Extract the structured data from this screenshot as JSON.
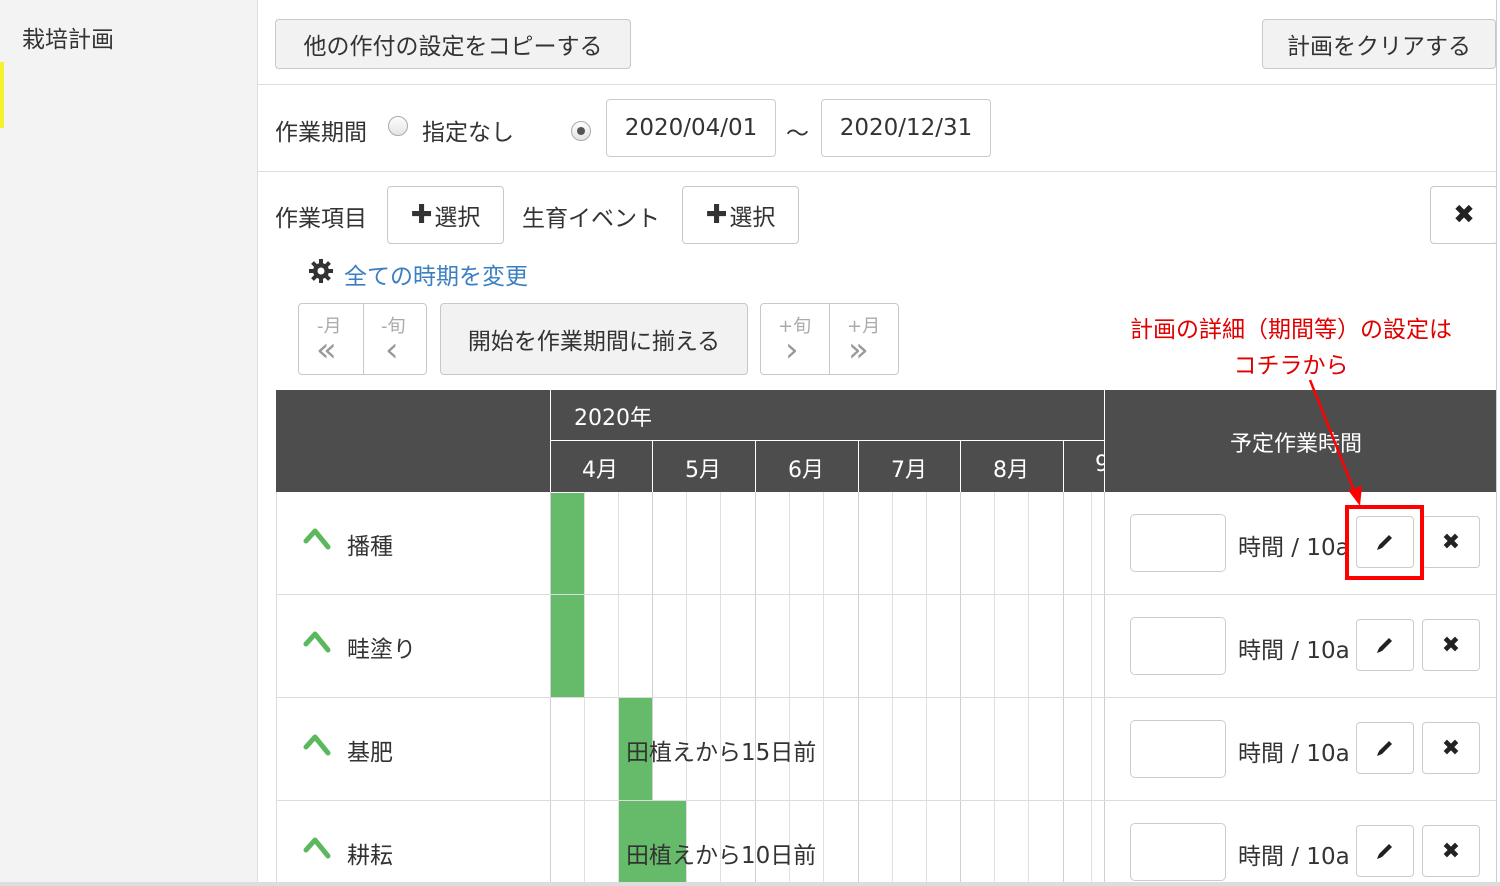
{
  "sidebar": {
    "title": "栽培計画"
  },
  "toolbar": {
    "copy_button": "他の作付の設定をコピーする",
    "clear_button": "計画をクリアする"
  },
  "period": {
    "label": "作業期間",
    "option_none": "指定なし",
    "start_date": "2020/04/01",
    "separator": "～",
    "end_date": "2020/12/31"
  },
  "items": {
    "work_label": "作業項目",
    "work_select": "選択",
    "event_label": "生育イベント",
    "event_select": "選択"
  },
  "change_all_link": "全ての時期を変更",
  "shift": {
    "minus_month": "-月",
    "minus_jun": "-旬",
    "align_button": "開始を作業期間に揃える",
    "plus_jun": "+旬",
    "plus_month": "+月"
  },
  "gantt": {
    "year": "2020年",
    "months": [
      "4月",
      "5月",
      "6月",
      "7月",
      "8月",
      "9"
    ],
    "hours_header": "予定作業時間",
    "unit": "時間 / 10a",
    "rows": [
      {
        "name": "播種",
        "bar_text": ""
      },
      {
        "name": "畦塗り",
        "bar_text": ""
      },
      {
        "name": "基肥",
        "bar_text": "田植えから15日前"
      },
      {
        "name": "耕耘",
        "bar_text": "田植えから10日前"
      }
    ]
  },
  "annotation": {
    "line1": "計画の詳細（期間等）の設定は",
    "line2": "コチラから"
  },
  "colors": {
    "bar": "#66bb6a",
    "header": "#4d4d4d",
    "annotation": "#ff0000",
    "link": "#3a7fc1"
  }
}
